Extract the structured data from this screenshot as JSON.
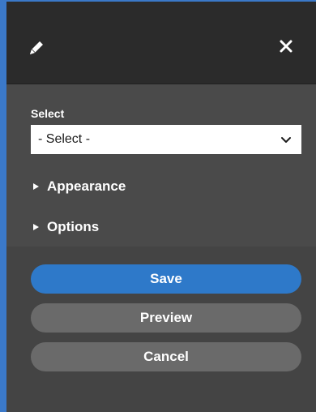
{
  "header": {
    "edit_icon": "pencil-icon",
    "close_icon": "close-icon"
  },
  "form": {
    "select_label": "Select",
    "select_value": "- Select -"
  },
  "sections": {
    "appearance": "Appearance",
    "options": "Options"
  },
  "actions": {
    "save": "Save",
    "preview": "Preview",
    "cancel": "Cancel"
  },
  "colors": {
    "accent": "#3b79c9",
    "header_bg": "#2b2b2b",
    "panel_bg": "#444444",
    "secondary_button": "#6a6a6a"
  }
}
